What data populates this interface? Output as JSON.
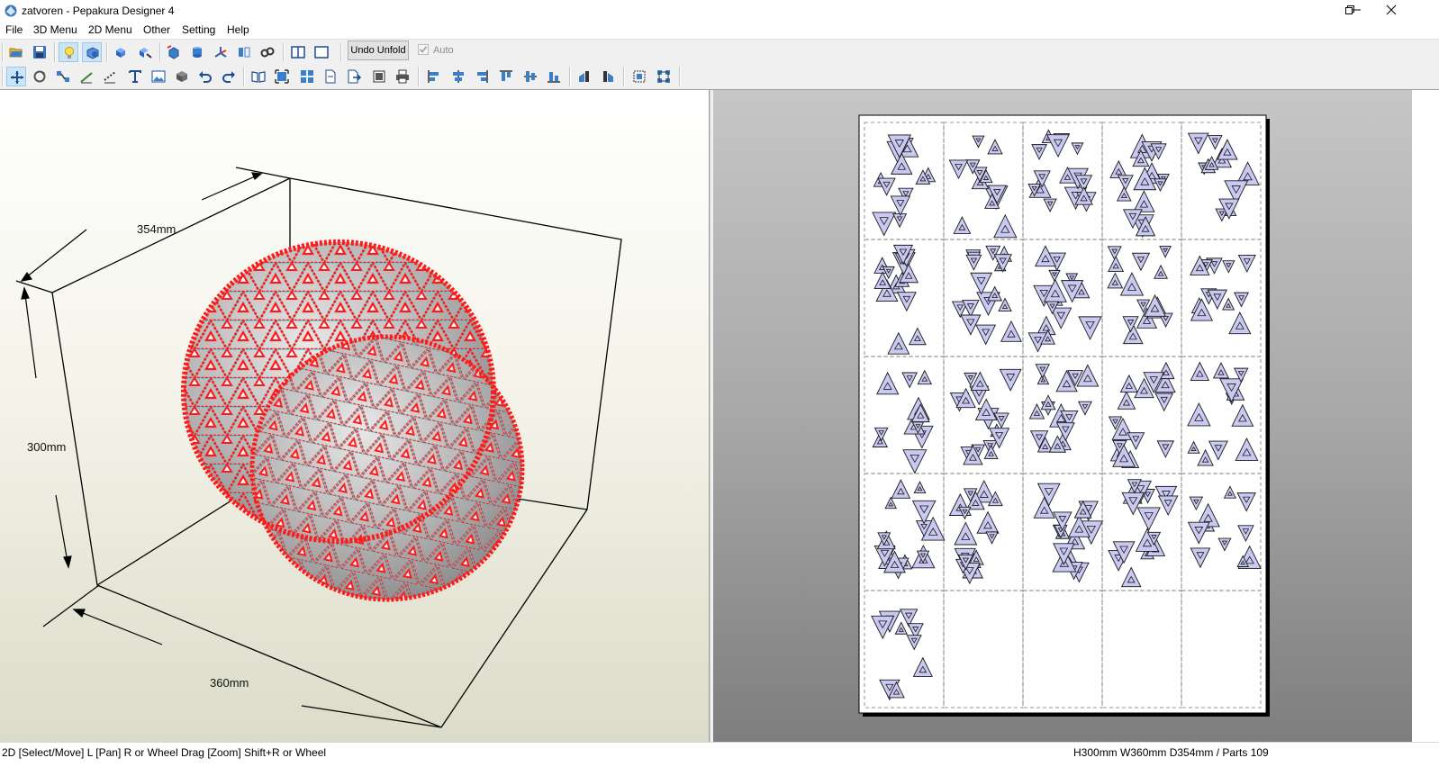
{
  "window": {
    "title": "zatvoren - Pepakura Designer 4",
    "minimize_glyph": "—",
    "restore_glyph": "❐",
    "close_glyph": "✕"
  },
  "menu": [
    "File",
    "3D Menu",
    "2D Menu",
    "Other",
    "Setting",
    "Help"
  ],
  "toolbar": {
    "undo_unfold_label": "Undo Unfold",
    "auto_label": "Auto",
    "auto_checked": true,
    "auto_enabled": false,
    "row1_icons": [
      "open-icon",
      "save-icon",
      "light-icon",
      "texture-icon",
      "unfold-icon",
      "edit-unfold-icon",
      "box-icon",
      "cylinder-icon",
      "axis-icon",
      "flip-icon",
      "view-icon",
      "split-view-icon",
      "single-view-icon"
    ],
    "row2_icons": [
      "select-icon",
      "rotate-icon",
      "join-icon",
      "line-icon",
      "fold-line-icon",
      "text-icon",
      "image-icon",
      "3d-box-icon",
      "undo-icon",
      "redo-icon",
      "book-icon",
      "fit-icon",
      "grid-icon",
      "page-icon",
      "page-export-icon",
      "print-preview-icon",
      "print-icon",
      "align-left-icon",
      "align-hcenter-icon",
      "align-right-icon",
      "align-top-icon",
      "align-vcenter-icon",
      "align-bottom-icon",
      "arrange-left-icon",
      "arrange-right-icon",
      "select-all-icon",
      "group-icon"
    ]
  },
  "view3d": {
    "dimensions": {
      "width": "354mm",
      "height": "300mm",
      "depth": "360mm"
    }
  },
  "view2d": {
    "page_columns": 5,
    "page_rows": 5,
    "part_color": "#c9c9f2"
  },
  "status": {
    "left": "2D [Select/Move] L [Pan] R or Wheel Drag [Zoom] Shift+R or Wheel",
    "right": "H300mm W360mm D354mm / Parts 109"
  },
  "colors": {
    "mesh_edge": "#ff1a1a",
    "mesh_seam": "#3ac9d6",
    "accent": "#0078d7"
  }
}
